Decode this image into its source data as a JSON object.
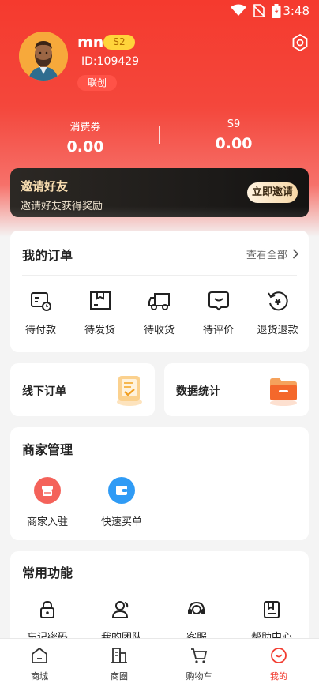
{
  "status_bar": {
    "time": "3:48"
  },
  "profile": {
    "username": "mn",
    "level_badge": "S2",
    "id_text": "ID:109429",
    "tag": "联创"
  },
  "stats": [
    {
      "label": "消费券",
      "value": "0.00"
    },
    {
      "label": "S9",
      "value": "0.00"
    }
  ],
  "invite": {
    "title": "邀请好友",
    "subtitle": "邀请好友获得奖励",
    "button": "立即邀请"
  },
  "orders": {
    "title": "我的订单",
    "see_all": "查看全部",
    "items": [
      {
        "label": "待付款",
        "icon": "payment-pending-icon"
      },
      {
        "label": "待发货",
        "icon": "package-icon"
      },
      {
        "label": "待收货",
        "icon": "truck-icon"
      },
      {
        "label": "待评价",
        "icon": "review-icon"
      },
      {
        "label": "退货退款",
        "icon": "refund-icon"
      }
    ]
  },
  "quick_cards": [
    {
      "label": "线下订单",
      "icon": "offline-order-icon"
    },
    {
      "label": "数据统计",
      "icon": "data-folder-icon"
    }
  ],
  "merchant": {
    "title": "商家管理",
    "items": [
      {
        "label": "商家入驻",
        "icon": "shop-icon",
        "color": "#f4625a"
      },
      {
        "label": "快速买单",
        "icon": "wallet-icon",
        "color": "#2f9bf5"
      }
    ]
  },
  "common": {
    "title": "常用功能",
    "items": [
      {
        "label": "忘记密码",
        "icon": "lock-icon"
      },
      {
        "label": "我的团队",
        "icon": "team-icon"
      },
      {
        "label": "客服",
        "icon": "headset-icon"
      },
      {
        "label": "帮助中心",
        "icon": "book-icon"
      }
    ]
  },
  "tabbar": [
    {
      "label": "商城",
      "icon": "home-icon"
    },
    {
      "label": "商圈",
      "icon": "buildings-icon"
    },
    {
      "label": "购物车",
      "icon": "cart-icon"
    },
    {
      "label": "我的",
      "icon": "profile-smile-icon",
      "active": true
    }
  ],
  "colors": {
    "brand_red": "#f23c30",
    "badge_yellow": "#ffd43b",
    "invite_dark": "#1d1b19"
  }
}
